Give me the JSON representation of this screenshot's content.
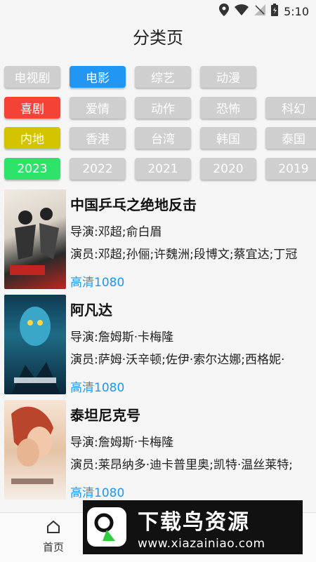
{
  "status": {
    "time": "5:10"
  },
  "header": {
    "title": "分类页"
  },
  "filters": {
    "categories": [
      "电视剧",
      "电影",
      "综艺",
      "动漫"
    ],
    "genres": [
      "喜剧",
      "爱情",
      "动作",
      "恐怖",
      "科幻"
    ],
    "regions": [
      "内地",
      "香港",
      "台湾",
      "韩国",
      "泰国"
    ],
    "years": [
      "2023",
      "2022",
      "2021",
      "2020",
      "2019"
    ]
  },
  "movies": [
    {
      "title": "中国乒乓之绝地反击",
      "director": "导演:邓超;俞白眉",
      "actors": "演员:邓超;孙俪;许魏洲;段博文;蔡宜达;丁冠",
      "quality": "高清1080"
    },
    {
      "title": "阿凡达",
      "director": "导演:詹姆斯·卡梅隆",
      "actors": "演员:萨姆·沃辛顿;佐伊·索尔达娜;西格妮·",
      "quality": "高清1080"
    },
    {
      "title": "泰坦尼克号",
      "director": "导演:詹姆斯·卡梅隆",
      "actors": "演员:莱昂纳多·迪卡普里奥;凯特·温丝莱特;",
      "quality": "高清1080"
    }
  ],
  "nav": {
    "home_label": "首页"
  },
  "watermark": {
    "title": "下载鸟资源",
    "url": "www.xiazainiao.com"
  },
  "colors": {
    "accent": "#2196f3",
    "red": "#f44336",
    "yellow": "#d4c400",
    "green": "#2ee36a",
    "chip": "#cfcfcf"
  }
}
